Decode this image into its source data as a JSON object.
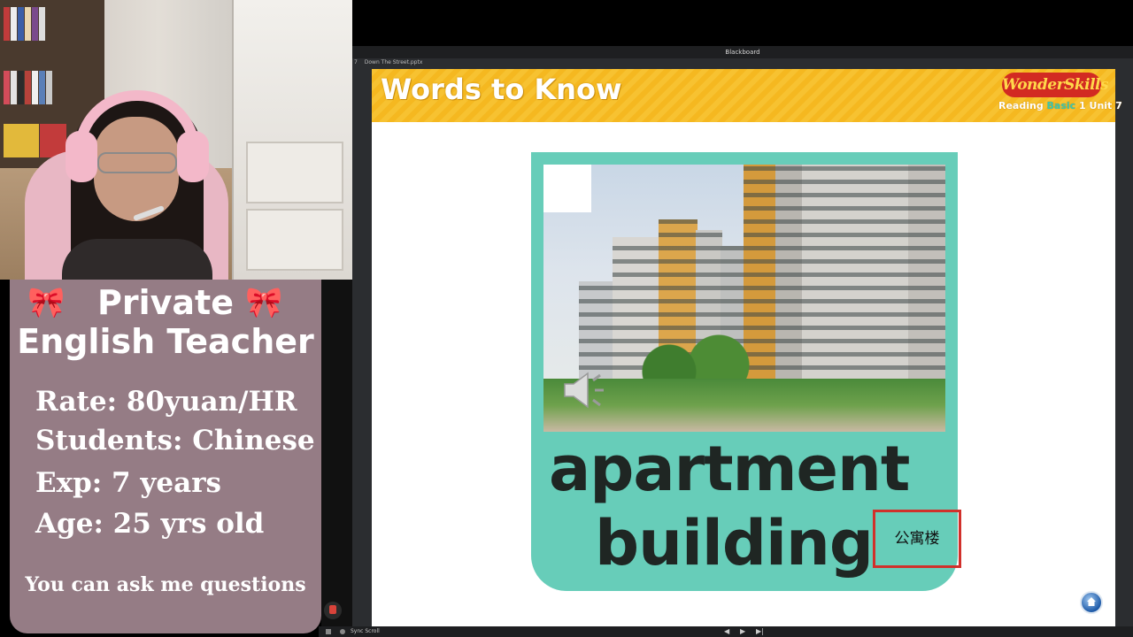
{
  "info_card": {
    "title_line1": "Private",
    "title_line2": "English Teacher",
    "bow_left": "🎀",
    "bow_right": "🎀",
    "rate": "Rate: 80yuan/HR",
    "students": "Students: Chinese",
    "experience": "Exp: 7 years",
    "age": "Age: 25 yrs old",
    "footer": "You can ask me questions"
  },
  "window": {
    "title": "Blackboard",
    "tab_number": "7",
    "tab_label": "Down The Street.pptx"
  },
  "slide": {
    "title": "Words to Know",
    "brand_logo": "WonderSkills",
    "brand_sub_1": "Reading ",
    "brand_sub_2": "Basic",
    "brand_sub_3": " 1 Unit 7",
    "word_line1": "apartment",
    "word_line2": "building",
    "translation": "公寓楼"
  },
  "bottom_bar": {
    "sync_label": "Sync Scroll",
    "prev": "◀",
    "play": "▶",
    "next": "▶|"
  },
  "colors": {
    "card_teal": "#67cdb9",
    "header_yellow": "#f7c231",
    "info_card_mauve": "#957c85",
    "translation_border": "#d1302b"
  },
  "icons": [
    "speaker-icon",
    "home-icon",
    "chat-icon",
    "bow-icon"
  ]
}
